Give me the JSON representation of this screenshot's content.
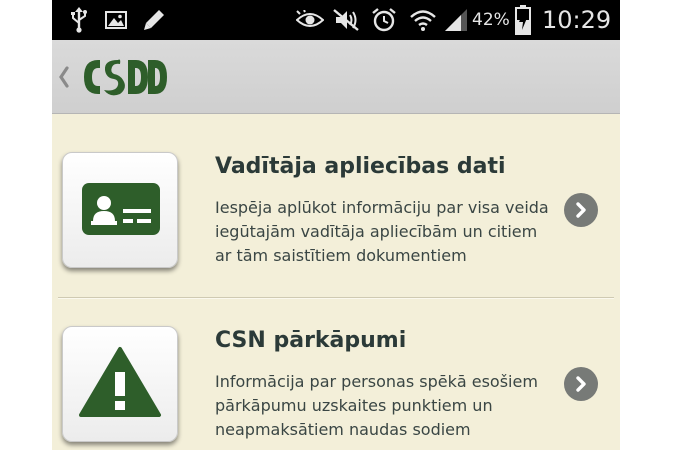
{
  "status_bar": {
    "battery_percent": "42%",
    "time": "10:29",
    "left_icons": [
      "usb-icon",
      "image-icon",
      "pencil-icon"
    ],
    "right_icons": [
      "eye-icon",
      "mute-icon",
      "alarm-icon",
      "wifi-icon",
      "signal-icon",
      "battery-icon"
    ]
  },
  "action_bar": {
    "back_icon": "chevron-left-icon",
    "logo_text": "CSDD"
  },
  "colors": {
    "brand_green": "#2e5e2a",
    "background": "#f3efd9",
    "arrow_button": "#777a77"
  },
  "items": [
    {
      "icon": "license-card-icon",
      "title": "Vadītāja apliecības dati",
      "description": "Iespēja aplūkot informāciju par visa veida iegūtajām vadītāja apliecībām un citiem ar tām saistītiem dokumentiem",
      "arrow_icon": "chevron-right-icon"
    },
    {
      "icon": "warning-icon",
      "title": "CSN pārkāpumi",
      "description": "Informācija par personas spēkā esošiem pārkāpumu uzskaites punktiem un neapmaksātiem naudas sodiem",
      "arrow_icon": "chevron-right-icon"
    }
  ]
}
